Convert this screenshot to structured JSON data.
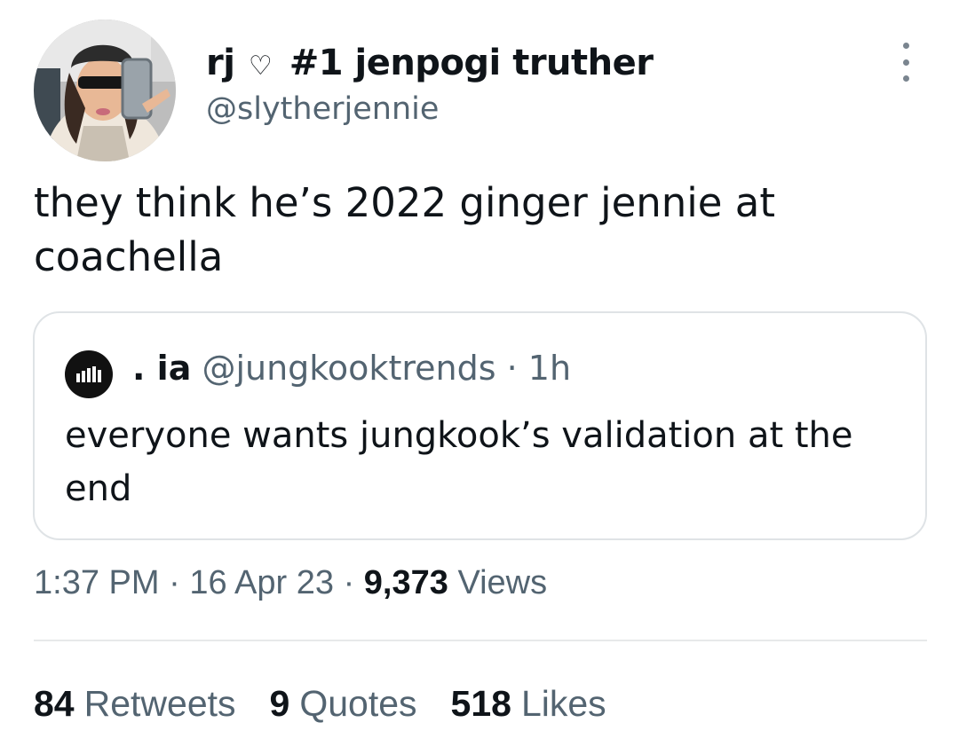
{
  "author": {
    "display_name": "rj",
    "name_emoji": "♡",
    "display_suffix": "#1 jenpogi truther",
    "handle": "@slytherjennie"
  },
  "tweet": {
    "text": "they think he’s 2022 ginger jennie at coachella"
  },
  "quoted": {
    "name": ". ia",
    "handle": "@jungkooktrends",
    "separator": "·",
    "time": "1h",
    "text": "everyone wants jungkook’s validation at the end"
  },
  "meta": {
    "time": "1:37 PM",
    "sep1": "·",
    "date": "16 Apr 23",
    "sep2": "·",
    "views_count": "9,373",
    "views_label": "Views"
  },
  "stats": [
    {
      "count": "84",
      "label": "Retweets"
    },
    {
      "count": "9",
      "label": "Quotes"
    },
    {
      "count": "518",
      "label": "Likes"
    }
  ],
  "icons": {
    "more": "more-vertical-icon",
    "quoted_avatar": "bar-chart-icon"
  },
  "colors": {
    "text": "#0f1419",
    "secondary": "#536471",
    "border": "#dfe3e6"
  }
}
